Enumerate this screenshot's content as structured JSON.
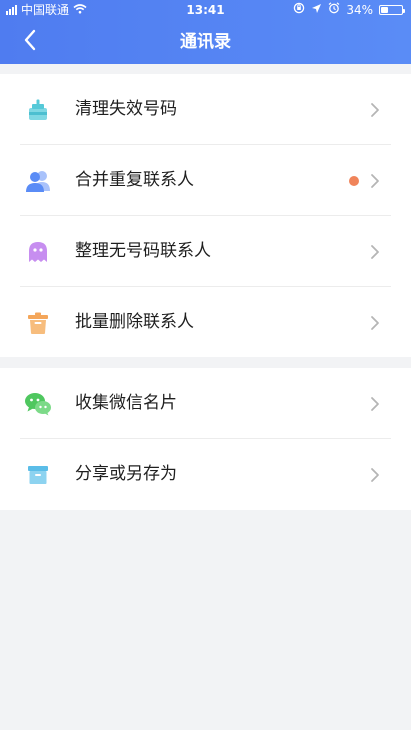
{
  "status_bar": {
    "carrier": "中国联通",
    "time": "13:41",
    "battery_percent": "34%",
    "battery_level": 0.34
  },
  "header": {
    "title": "通讯录",
    "back_icon": "back-icon",
    "gradient": [
      "#4f7cf0",
      "#5a8cf6"
    ]
  },
  "sections": [
    {
      "items": [
        {
          "label": "清理失效号码",
          "icon": "broom-icon",
          "color": "#55c9d8"
        },
        {
          "label": "合并重复联系人",
          "icon": "users-icon",
          "color": "#5a8cf6",
          "badge_dot": true,
          "badge_color": "#f0845a"
        },
        {
          "label": "整理无号码联系人",
          "icon": "ghost-icon",
          "color": "#c78ef0"
        },
        {
          "label": "批量删除联系人",
          "icon": "trash-icon",
          "color": "#f4a65a"
        }
      ]
    },
    {
      "items": [
        {
          "label": "收集微信名片",
          "icon": "wechat-icon",
          "color": "#4fc75f"
        },
        {
          "label": "分享或另存为",
          "icon": "archive-box-icon",
          "color": "#5bbde8"
        }
      ]
    }
  ]
}
